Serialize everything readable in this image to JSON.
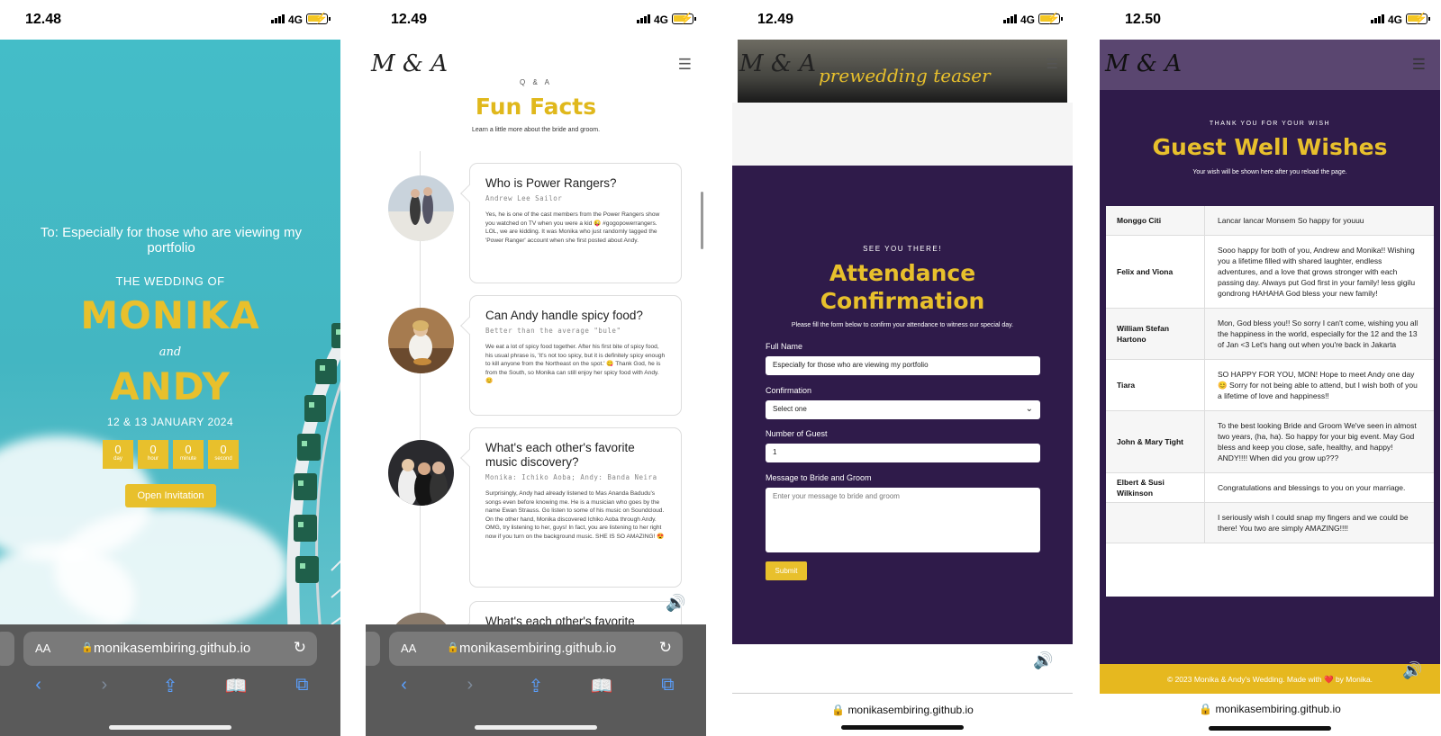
{
  "status": {
    "p1_time": "12.48",
    "p2_time": "12.49",
    "p3_time": "12.49",
    "p4_time": "12.50",
    "network": "4G"
  },
  "browser": {
    "url": "monikasembiring.github.io",
    "aa_label": "AA"
  },
  "hero": {
    "to_line": "To: Especially for those who are viewing my portfolio",
    "wedding_of": "THE WEDDING OF",
    "bride": "MONIKA",
    "and": "and",
    "groom": "ANDY",
    "date": "12 & 13 JANUARY 2024",
    "countdown": [
      {
        "value": "0",
        "unit": "day"
      },
      {
        "value": "0",
        "unit": "hour"
      },
      {
        "value": "0",
        "unit": "minute"
      },
      {
        "value": "0",
        "unit": "second"
      }
    ],
    "open_button": "Open Invitation"
  },
  "brand": {
    "logo": "M & A"
  },
  "fun_facts": {
    "eyebrow": "Q & A",
    "title": "Fun Facts",
    "subtitle": "Learn a little more about the bride and groom.",
    "items": [
      {
        "question": "Who is Power Rangers?",
        "answer_short": "Andrew Lee Sailor",
        "body": "Yes, he is one of the cast members from the Power Rangers show you watched on TV when you were a kid 😜 #gogopowerrangers. LOL, we are kidding. It was Monika who just randomly tagged the 'Power Ranger' account when she first posted about Andy."
      },
      {
        "question": "Can Andy handle spicy food?",
        "answer_short": "Better than the average \"bule\"",
        "body": "We eat a lot of spicy food together. After his first bite of spicy food, his usual phrase is, 'It's not too spicy, but it is definitely spicy enough to kill anyone from the Northeast on the spot.' 😋 Thank God, he is from the South, so Monika can still enjoy her spicy food with Andy. 😊"
      },
      {
        "question": "What's each other's favorite music discovery?",
        "answer_short": "Monika: Ichiko Aoba; Andy: Banda Neira",
        "body": "Surprisingly, Andy had already listened to Mas Ananda Badudu's songs even before knowing me. He is a musician who goes by the name Ewan Strauss. Go listen to some of his music on Soundcloud. On the other hand, Monika discovered Ichiko Aoba through Andy. OMG, try listening to her, guys! In fact, you are listening to her right now if you turn on the background music. SHE IS SO AMAZING! 😍"
      },
      {
        "question": "What's each other's favorite",
        "answer_short": "",
        "body": ""
      }
    ]
  },
  "teaser": {
    "label": "prewedding teaser"
  },
  "rsvp": {
    "eyebrow": "SEE YOU THERE!",
    "title_line1": "Attendance",
    "title_line2": "Confirmation",
    "subtitle": "Please fill the form below to confirm your attendance to witness our special day.",
    "name_label": "Full Name",
    "name_value": "Especially for those who are viewing my portfolio",
    "confirm_label": "Confirmation",
    "confirm_value": "Select one",
    "guests_label": "Number of Guest",
    "guests_value": "1",
    "message_label": "Message to Bride and Groom",
    "message_placeholder": "Enter your message to bride and groom",
    "submit": "Submit"
  },
  "wishes": {
    "eyebrow": "THANK YOU FOR YOUR WISH",
    "title": "Guest Well Wishes",
    "subtitle": "Your wish will be shown here after you reload the page.",
    "rows": [
      {
        "name": "Monggo Citi",
        "message": "Lancar lancar Monsem So happy for youuu"
      },
      {
        "name": "Felix and Viona",
        "message": "Sooo happy for both of you, Andrew and Monika!! Wishing you a lifetime filled with shared laughter, endless adventures, and a love that grows stronger with each passing day. Always put God first in your family! less gigilu gondrong HAHAHA God bless your new family!"
      },
      {
        "name": "William Stefan Hartono",
        "message": "Mon, God bless you!! So sorry I can't come, wishing you all the happiness in the world, especially for the 12 and the 13 of Jan <3 Let's hang out when you're back in Jakarta"
      },
      {
        "name": "Tiara",
        "message": "SO HAPPY FOR YOU, MON! Hope to meet Andy one day 😊 Sorry for not being able to attend, but I wish both of you a lifetime of love and happiness!!"
      },
      {
        "name": "John & Mary Tight",
        "message": "To the best looking Bride and Groom We've seen in almost two years, (ha, ha). So happy for your big event. May God bless and keep you close, safe, healthy, and happy! ANDY!!!! When did you grow up???"
      },
      {
        "name": "Elbert & Susi Wilkinson",
        "message": "Congratulations and blessings to you on your marriage."
      },
      {
        "name": "",
        "message": "I seriously wish I could snap my fingers and we could be there! You two are simply AMAZING!!!!"
      }
    ],
    "footer": "© 2023 Monika & Andy's Wedding. Made with ❤️ by Monika."
  }
}
